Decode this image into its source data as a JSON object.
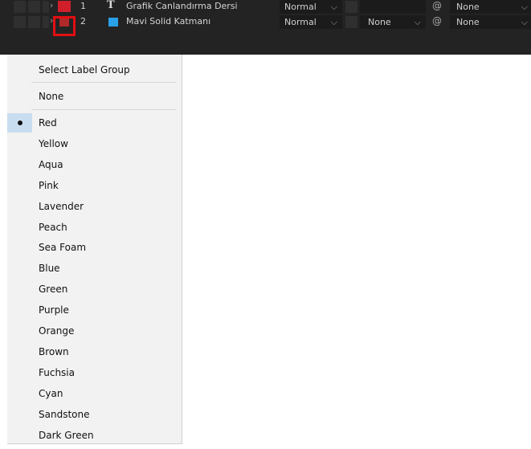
{
  "timeline": {
    "rows": [
      {
        "number": "1",
        "type_icon": "T",
        "name": "Grafik Canlandırma Dersi",
        "mode": "Normal",
        "track_matte": "",
        "parent": "None",
        "label_color": "#d01f2b"
      },
      {
        "number": "2",
        "type_icon": "solid-layer-icon",
        "name": "Mavi Solid Katmanı",
        "mode": "Normal",
        "track_matte": "None",
        "parent": "None",
        "label_color": "#b02a2a",
        "solid_color": "#2aa0e8"
      }
    ],
    "dropdown_glyph": "⌵",
    "pickwhip_glyph": "@",
    "chevron_glyph": "›",
    "highlight_color": "#e10f12"
  },
  "label_menu": {
    "header": "Select Label Group",
    "none": "None",
    "selected": "Red",
    "colors": [
      "Red",
      "Yellow",
      "Aqua",
      "Pink",
      "Lavender",
      "Peach",
      "Sea Foam",
      "Blue",
      "Green",
      "Purple",
      "Orange",
      "Brown",
      "Fuchsia",
      "Cyan",
      "Sandstone",
      "Dark Green"
    ]
  }
}
